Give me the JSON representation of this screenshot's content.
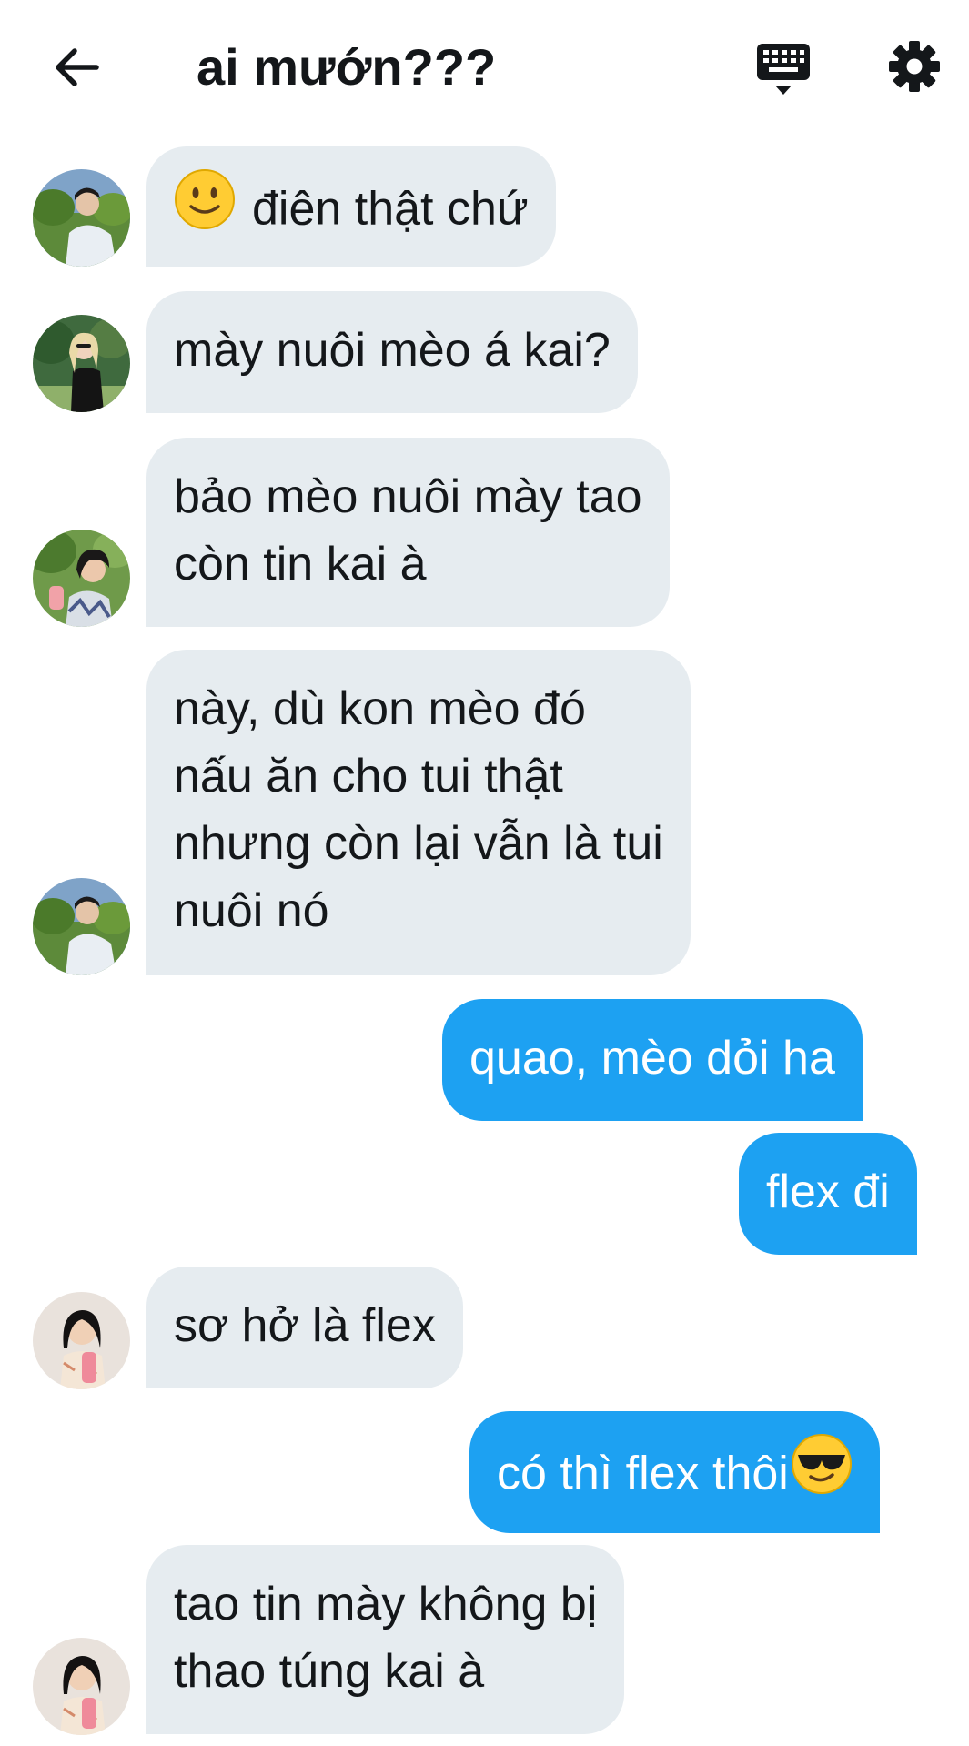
{
  "header": {
    "title": "ai mướn???"
  },
  "colors": {
    "incoming_bubble": "#e6ecf0",
    "outgoing_bubble": "#1da1f2",
    "text": "#14171a"
  },
  "messages": [
    {
      "direction": "incoming",
      "text": "điên thật chứ",
      "emoji": "slightly-smiling-face-icon"
    },
    {
      "direction": "incoming",
      "text": "mày nuôi mèo á kai?"
    },
    {
      "direction": "incoming",
      "lines": [
        "bảo mèo nuôi mày tao",
        "còn tin kai à"
      ]
    },
    {
      "direction": "incoming",
      "lines": [
        "này, dù kon mèo đó",
        "nấu ăn cho tui thật",
        "nhưng còn lại vẫn là tui",
        "nuôi nó"
      ]
    },
    {
      "direction": "outgoing",
      "text": "quao, mèo dỏi ha"
    },
    {
      "direction": "outgoing",
      "text": "flex đi"
    },
    {
      "direction": "incoming",
      "text": "sơ hở là flex"
    },
    {
      "direction": "outgoing",
      "text": "có thì flex thôi",
      "emoji": "sunglasses-face-icon"
    },
    {
      "direction": "incoming",
      "lines": [
        "tao tin mày không bị",
        "thao túng kai à"
      ]
    }
  ]
}
